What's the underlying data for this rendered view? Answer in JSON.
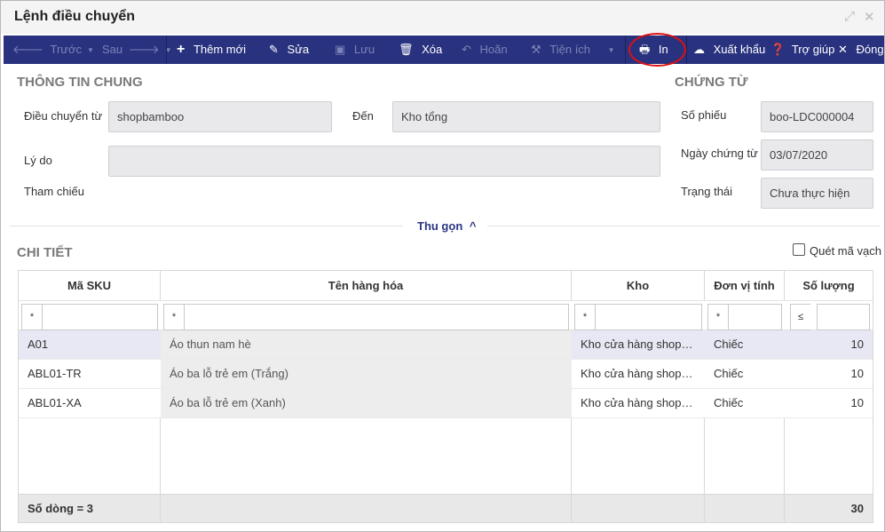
{
  "window": {
    "title": "Lệnh điều chuyển"
  },
  "toolbar": {
    "prev_label": "Trước",
    "next_label": "Sau",
    "add_label": "Thêm mới",
    "edit_label": "Sửa",
    "save_label": "Lưu",
    "delete_label": "Xóa",
    "undo_label": "Hoãn",
    "utility_label": "Tiện ích",
    "print_label": "In",
    "export_label": "Xuất khẩu",
    "help_label": "Trợ giúp",
    "close_label": "Đóng"
  },
  "general": {
    "section_title": "THÔNG TIN CHUNG",
    "from_label": "Điều chuyển từ",
    "from_value": "shopbamboo",
    "to_label": "Đến",
    "to_value": "Kho tổng",
    "reason_label": "Lý do",
    "reason_value": "",
    "reference_label": "Tham chiếu"
  },
  "voucher": {
    "section_title": "CHỨNG TỪ",
    "number_label": "Số phiếu",
    "number_value": "boo-LDC000004",
    "date_label": "Ngày chứng từ",
    "date_value": "03/07/2020",
    "status_label": "Trạng thái",
    "status_value": "Chưa thực hiện"
  },
  "collapse_label": "Thu gọn",
  "detail": {
    "section_title": "CHI TIẾT",
    "scan_barcode_label": "Quét mã vạch",
    "scan_barcode_checked": false,
    "columns": [
      "Mã SKU",
      "Tên hàng hóa",
      "Kho",
      "Đơn vị tính",
      "Số lượng"
    ],
    "filter_ops": [
      "*",
      "*",
      "*",
      "*",
      "≤"
    ],
    "rows": [
      {
        "sku": "A01",
        "name": "Áo thun nam hè",
        "warehouse": "Kho cửa hàng shopbamboo",
        "unit": "Chiếc",
        "qty": "10"
      },
      {
        "sku": "ABL01-TR",
        "name": "Áo ba lỗ trẻ em (Trắng)",
        "warehouse": "Kho cửa hàng shopbamboo",
        "unit": "Chiếc",
        "qty": "10"
      },
      {
        "sku": "ABL01-XA",
        "name": "Áo ba lỗ trẻ em (Xanh)",
        "warehouse": "Kho cửa hàng shopbamboo",
        "unit": "Chiếc",
        "qty": "10"
      }
    ],
    "footer_rows_label": "Số dòng = 3",
    "footer_total_qty": "30"
  },
  "colors": {
    "toolbar_bg": "#29327e",
    "highlight_ring": "#d11111",
    "selected_row": "#e7e8f3"
  }
}
